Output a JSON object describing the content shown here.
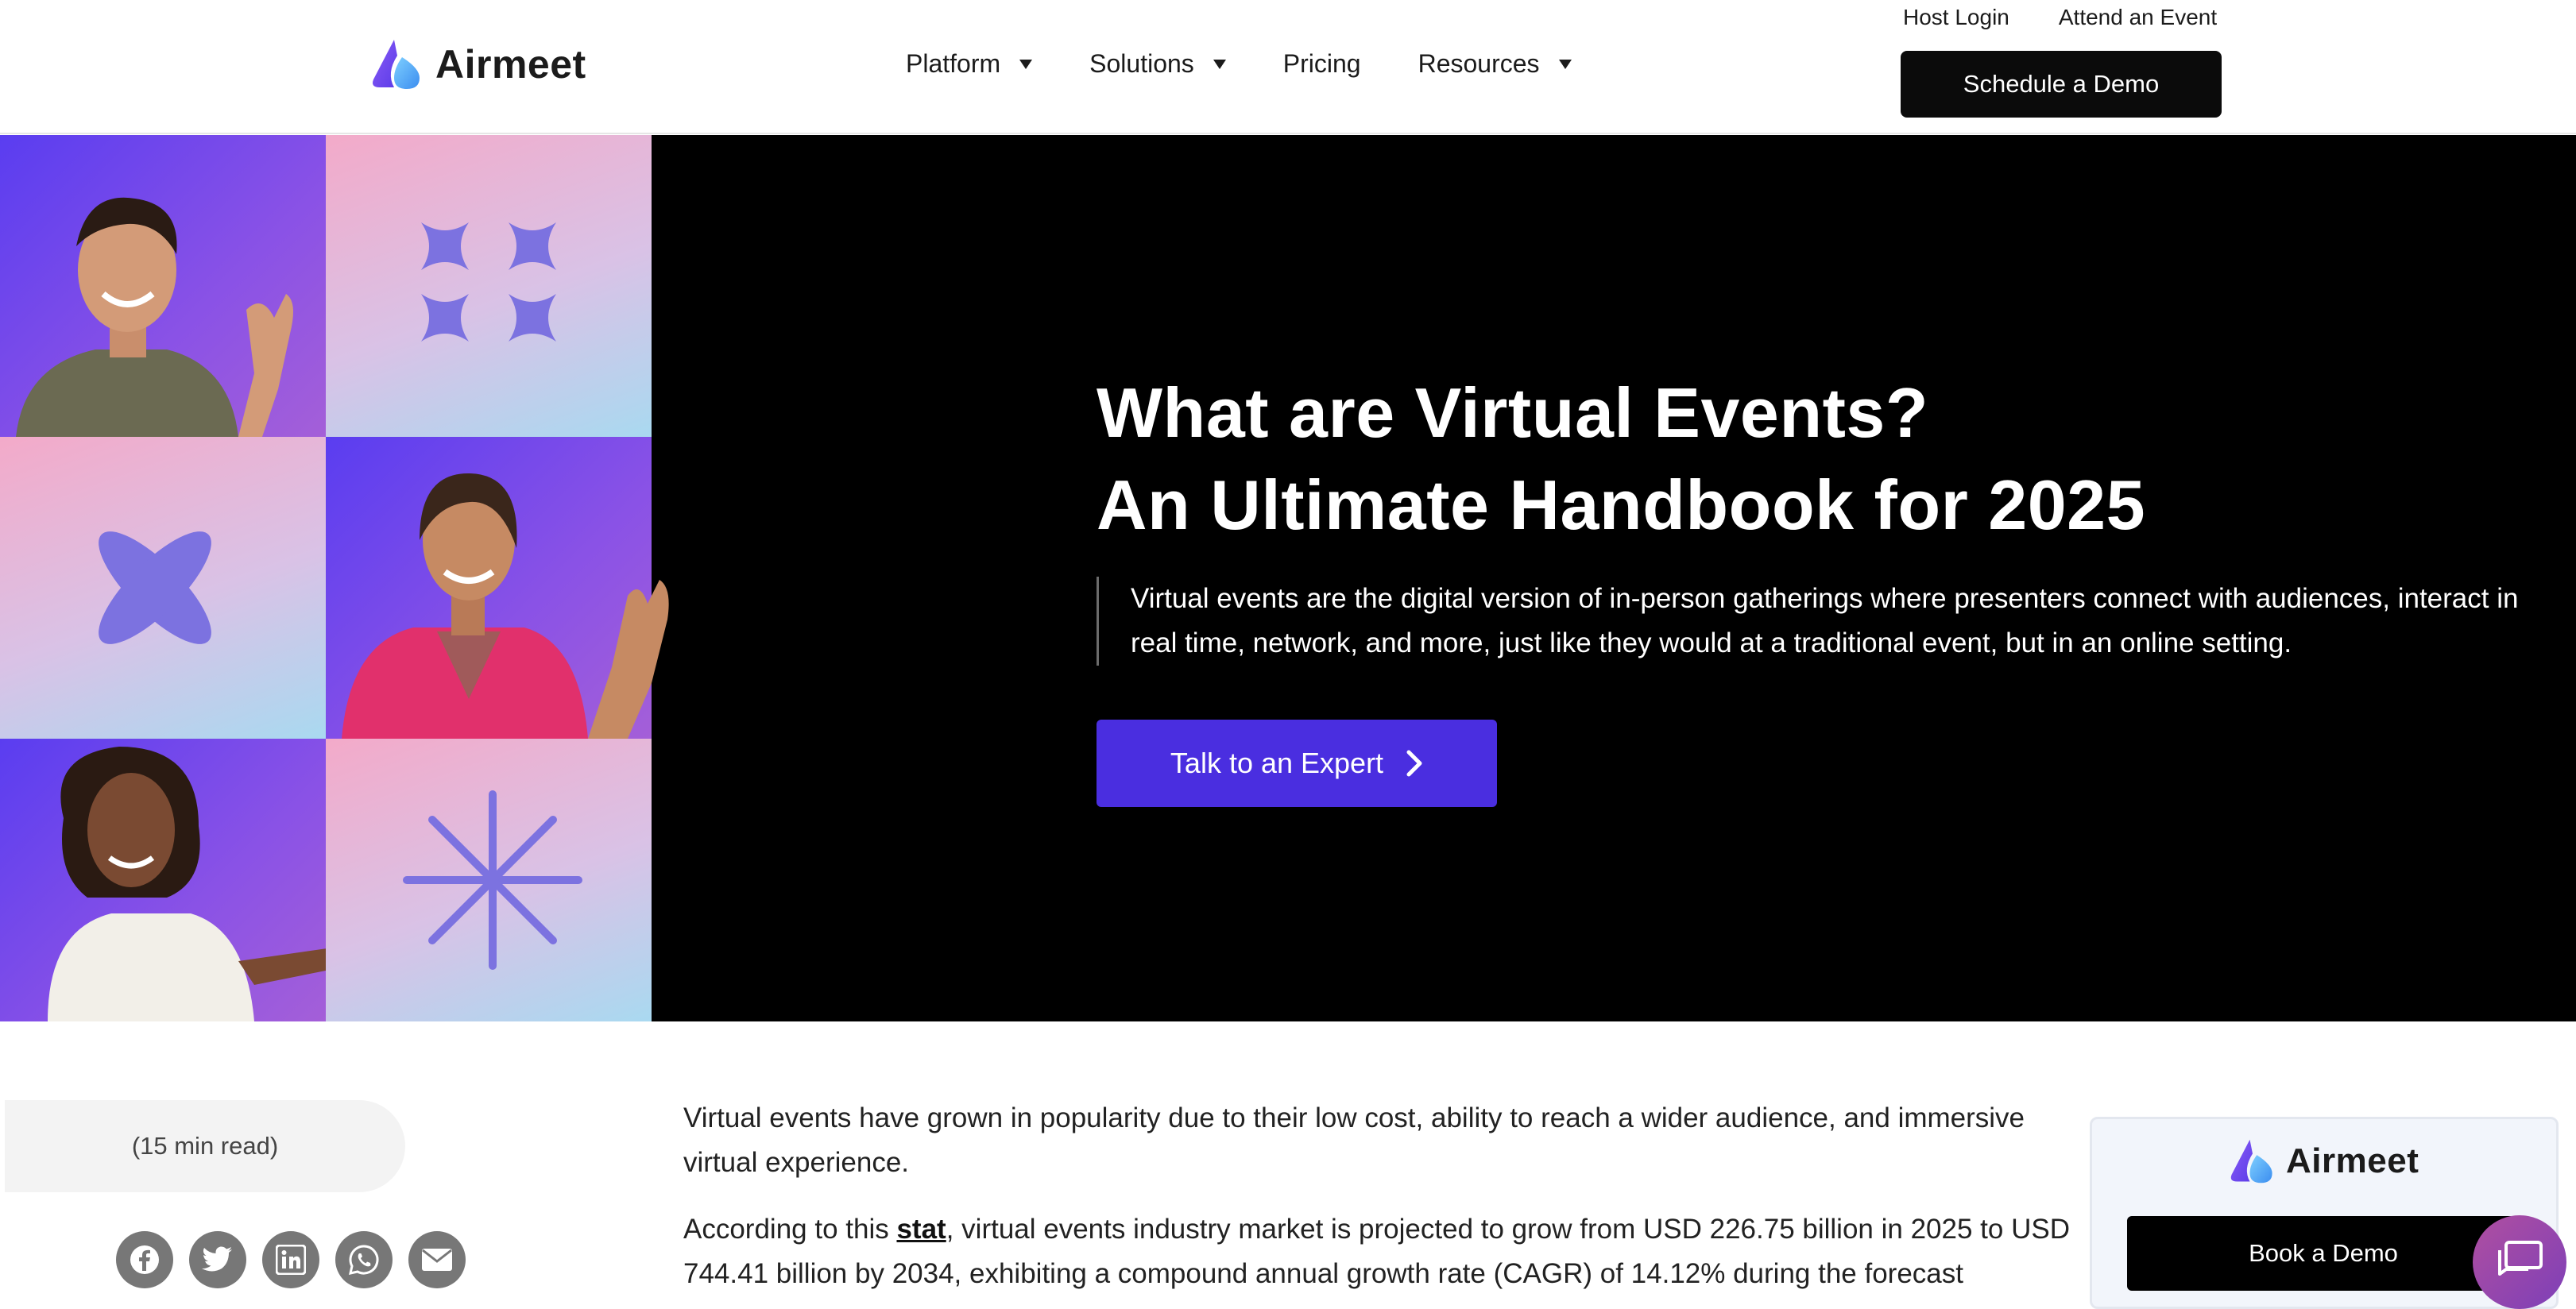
{
  "header": {
    "brand": "Airmeet",
    "nav": [
      {
        "label": "Platform",
        "has_dropdown": true
      },
      {
        "label": "Solutions",
        "has_dropdown": true
      },
      {
        "label": "Pricing",
        "has_dropdown": false
      },
      {
        "label": "Resources",
        "has_dropdown": true
      }
    ],
    "top_links": {
      "host_login": "Host Login",
      "attend_event": "Attend an Event"
    },
    "cta": "Schedule a Demo"
  },
  "hero": {
    "title_line1": "What are Virtual Events?",
    "title_line2": "An Ultimate Handbook for 2025",
    "quote": "Virtual events are the digital version of in-person gatherings where presenters connect with audiences, interact in real time, network, and more, just like they would at a traditional event, but in an online setting.",
    "cta": "Talk to an Expert"
  },
  "article": {
    "read_time": "(15 min read)",
    "share_icons": [
      "facebook-icon",
      "twitter-icon",
      "linkedin-icon",
      "whatsapp-icon",
      "email-icon"
    ],
    "para1": "Virtual events have grown in popularity due to their low cost, ability to reach a wider audience, and immersive virtual experience.",
    "para2_prefix": "According to this ",
    "para2_link": "stat",
    "para2_suffix": ", virtual events industry market is projected to grow from USD 226.75 billion in 2025 to USD 744.41 billion by 2034, exhibiting a compound annual growth rate (CAGR) of 14.12% during the forecast"
  },
  "sidebar": {
    "brand": "Airmeet",
    "cta": "Book a Demo"
  },
  "colors": {
    "accent": "#4a2ee0",
    "hero_bg": "#000000",
    "logo_gradient_start": "#6a3cf0",
    "logo_gradient_end": "#4fc3f7"
  }
}
